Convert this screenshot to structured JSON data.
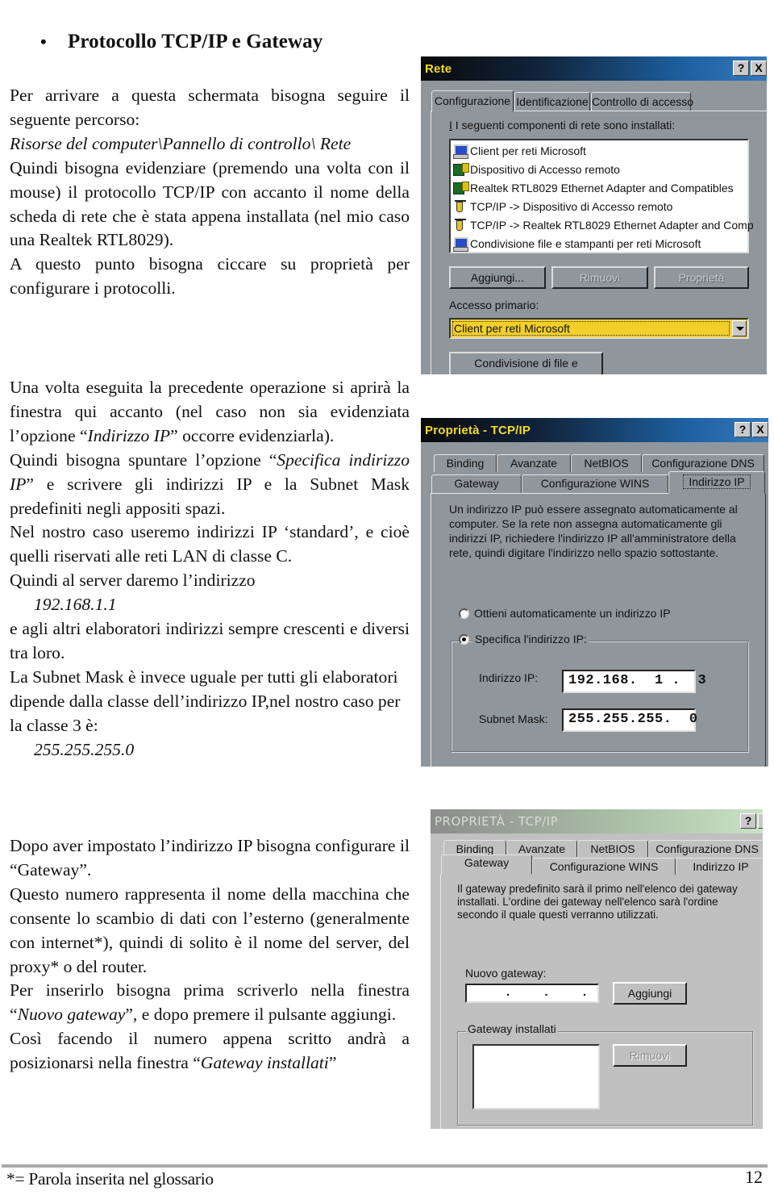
{
  "heading": {
    "bullet": "•",
    "title": "Protocollo TCP/IP e Gateway"
  },
  "block1": {
    "p1": "Per arrivare a questa schermata bisogna seguire il seguente percorso:",
    "path": "Risorse del computer\\Pannello di controllo\\ Rete",
    "p2": "Quindi bisogna evidenziare (premendo una volta con il mouse) il protocollo TCP/IP con accanto il nome della scheda di rete che è stata appena installata (nel mio caso una Realtek RTL8029).",
    "p3": "A questo punto bisogna ciccare su proprietà per configurare i protocolli."
  },
  "block2": {
    "p1_a": "Una volta eseguita la precedente operazione  si aprirà la finestra qui accanto (nel caso non sia evidenziata l’opzione “",
    "p1_em": "Indirizzo IP",
    "p1_b": "” occorre evidenziarla).",
    "p2_a": "Quindi bisogna spuntare l’opzione “",
    "p2_em": "Specifica indirizzo IP",
    "p2_b": "” e scrivere gli indirizzi IP e la Subnet Mask predefiniti negli appositi spazi.",
    "p3": "Nel nostro caso useremo indirizzi IP ‘standard’, e cioè quelli riservati alle reti LAN di classe C.",
    "p4": "Quindi al server daremo l’indirizzo",
    "server_ip": "192.168.1.1",
    "p5": "e agli altri elaboratori indirizzi sempre crescenti e diversi tra loro.",
    "p6": "La Subnet Mask è invece uguale per tutti gli elaboratori dipende dalla classe dell’indirizzo IP,nel nostro caso per la classe 3 è:",
    "mask": "255.255.255.0"
  },
  "block3": {
    "p1": "Dopo aver impostato l’indirizzo IP bisogna configurare il “Gateway”.",
    "p2": "Questo numero rappresenta il nome della macchina che consente lo scambio di dati con l’esterno (generalmente con internet*), quindi di solito è il nome del server, del proxy* o del router.",
    "p3_a": "Per inserirlo bisogna prima scriverlo nella finestra “",
    "p3_em": "Nuovo gateway",
    "p3_b": "”, e dopo premere il pulsante aggiungi.",
    "p4_a": "Così facendo il numero appena scritto andrà a posizionarsi nella finestra “",
    "p4_em": "Gateway installati",
    "p4_b": "”"
  },
  "footer": {
    "note": "*= Parola inserita nel glossario",
    "page": "12"
  },
  "dialog_rete": {
    "title": "Rete",
    "help": "?",
    "close": "X",
    "tabs": [
      "Configurazione",
      "Identificazione",
      "Controllo di accesso"
    ],
    "active_tab": "Configurazione",
    "list_label": "I seguenti componenti di rete sono installati:",
    "components": [
      {
        "icon": "pc",
        "label": "Client per reti Microsoft"
      },
      {
        "icon": "card",
        "label": "Dispositivo di Accesso remoto"
      },
      {
        "icon": "card",
        "label": "Realtek RTL8029 Ethernet Adapter and Compatibles"
      },
      {
        "icon": "plug",
        "label": "TCP/IP -> Dispositivo di Accesso remoto"
      },
      {
        "icon": "plug",
        "label": "TCP/IP -> Realtek RTL8029 Ethernet Adapter and Comp"
      },
      {
        "icon": "pc",
        "label": "Condivisione file e stampanti per reti Microsoft"
      }
    ],
    "btn_add": "Aggiungi...",
    "btn_remove": "Rimuovi",
    "btn_props": "Proprietà",
    "primary_label": "Accesso primario:",
    "primary_value": "Client per reti Microsoft",
    "btn_sharing": "Condivisione di file e stampanti..."
  },
  "dialog_tcpip": {
    "title": "Proprietà - TCP/IP",
    "help": "?",
    "close": "X",
    "tabs_row1": [
      "Binding",
      "Avanzate",
      "NetBIOS",
      "Configurazione DNS"
    ],
    "tabs_row2": [
      "Gateway",
      "Configurazione WINS",
      "Indirizzo IP"
    ],
    "active_tab": "Indirizzo IP",
    "description": "Un indirizzo IP può essere assegnato automaticamente al computer. Se la rete non assegna automaticamente gli indirizzi IP, richiedere l'indirizzo IP all'amministratore della rete, quindi digitare l'indirizzo nello spazio sottostante.",
    "radio_auto": "Ottieni automaticamente un indirizzo IP",
    "radio_specify": "Specifica l'indirizzo IP:",
    "selected_radio": "specify",
    "ip_label": "Indirizzo IP:",
    "ip_value": "192.168.  1 .  3",
    "mask_label": "Subnet Mask:",
    "mask_value": "255.255.255.  0"
  },
  "dialog_gateway": {
    "title": "PROPRIETÀ - TCP/IP",
    "help": "?",
    "close": "X",
    "tabs_row1": [
      "Binding",
      "Avanzate",
      "NetBIOS",
      "Configurazione DNS"
    ],
    "tabs_row2": [
      "Gateway",
      "Configurazione WINS",
      "Indirizzo IP"
    ],
    "active_tab": "Gateway",
    "description": "Il gateway predefinito sarà il primo nell'elenco dei gateway installati. L'ordine dei gateway nell'elenco sarà l'ordine secondo il quale questi verranno utilizzati.",
    "new_gateway_label": "Nuovo gateway:",
    "new_gateway_value": "   .    .    .",
    "btn_add": "Aggiungi",
    "installed_label": "Gateway installati",
    "installed": [],
    "btn_remove": "Rimuovi"
  }
}
